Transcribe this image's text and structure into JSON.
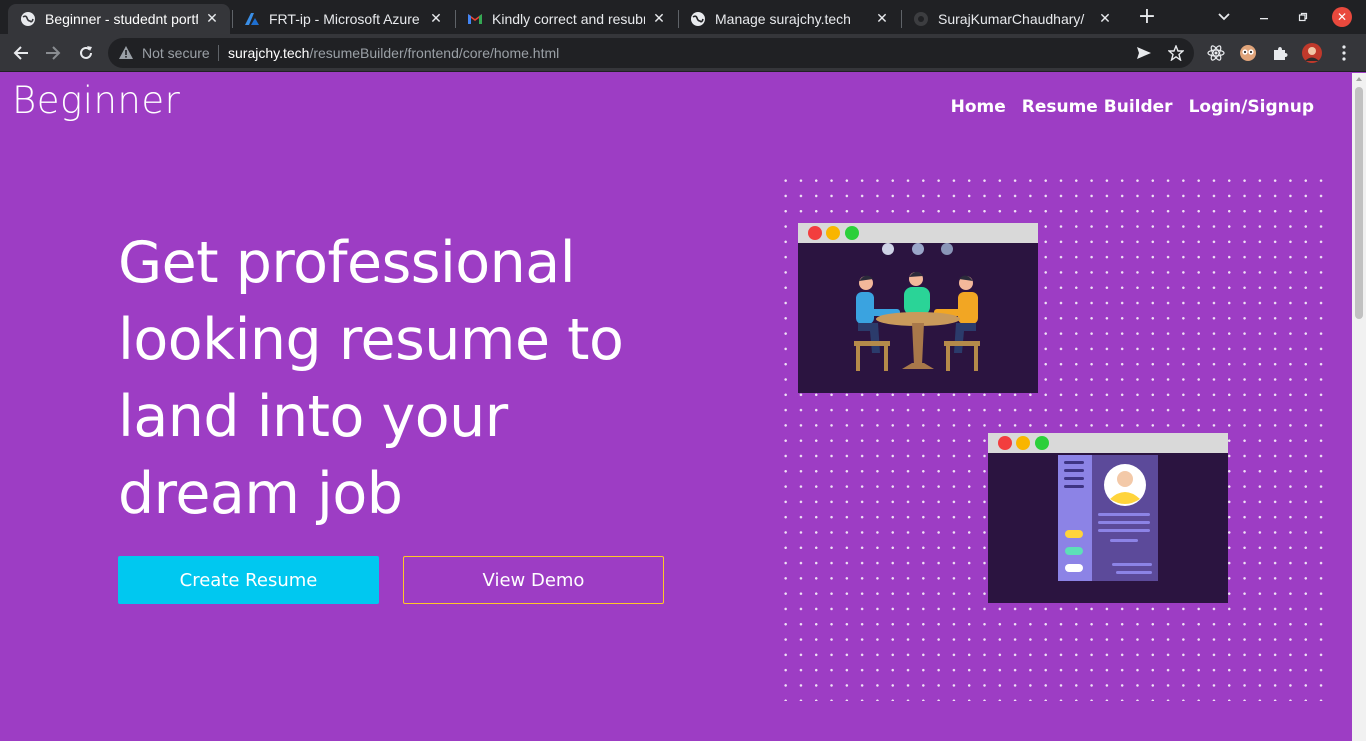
{
  "browser": {
    "tabs": [
      {
        "title": "Beginner - studednt portfolio",
        "icon": "globe-icon",
        "active": true
      },
      {
        "title": "FRT-ip - Microsoft Azure",
        "icon": "azure-icon",
        "active": false
      },
      {
        "title": "Kindly correct and resubmit",
        "icon": "gmail-icon",
        "active": false
      },
      {
        "title": "Manage surajchy.tech",
        "icon": "globe-icon",
        "active": false
      },
      {
        "title": "SurajKumarChaudhary/",
        "icon": "github-icon",
        "active": false
      }
    ],
    "new_tab_label": "+",
    "address": {
      "security_label": "Not secure",
      "host": "surajchy.tech",
      "path": "/resumeBuilder/frontend/core/home.html"
    }
  },
  "page": {
    "brand": "Beginner",
    "nav": [
      {
        "label": "Home"
      },
      {
        "label": "Resume Builder"
      },
      {
        "label": "Login/Signup"
      }
    ],
    "hero": {
      "headline_lines": [
        "Get professional",
        "looking resume to",
        "land into your",
        "dream job"
      ],
      "create_button": "Create Resume",
      "demo_button": "View Demo"
    }
  },
  "colors": {
    "page_bg": "#9d3dc4",
    "primary_button": "#00c8f0",
    "demo_border": "#ffc727",
    "window_dot_red": "#f23e3e",
    "window_dot_yellow": "#f9b500",
    "window_dot_green": "#2bcf3a"
  }
}
